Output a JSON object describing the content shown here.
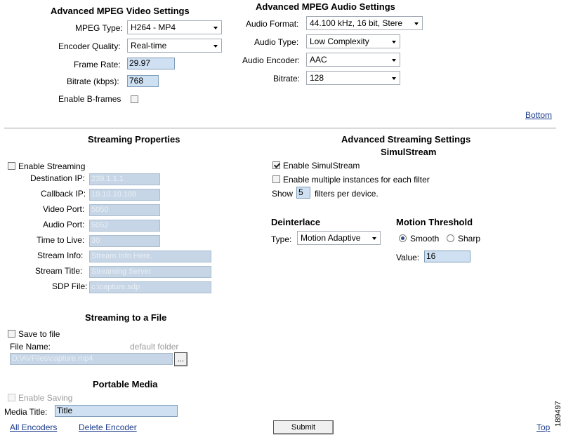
{
  "video": {
    "heading": "Advanced MPEG Video Settings",
    "mpeg_type_label": "MPEG Type:",
    "mpeg_type_value": "H264 - MP4",
    "encoder_quality_label": "Encoder Quality:",
    "encoder_quality_value": "Real-time",
    "frame_rate_label": "Frame Rate:",
    "frame_rate_value": "29.97",
    "bitrate_label": "Bitrate (kbps):",
    "bitrate_value": "768",
    "bframes_label": "Enable B-frames"
  },
  "audio": {
    "heading": "Advanced MPEG Audio Settings",
    "format_label": "Audio Format:",
    "format_value": "44.100 kHz, 16 bit, Stere",
    "type_label": "Audio Type:",
    "type_value": "Low Complexity",
    "encoder_label": "Audio Encoder:",
    "encoder_value": "AAC",
    "bitrate_label": "Bitrate:",
    "bitrate_value": "128"
  },
  "bottom_link": "Bottom",
  "streaming": {
    "heading": "Streaming Properties",
    "enable_label": "Enable Streaming",
    "dest_ip_label": "Destination IP:",
    "dest_ip_value": "239.1.1.1",
    "callback_ip_label": "Callback IP:",
    "callback_ip_value": "10.10.10.108",
    "video_port_label": "Video Port:",
    "video_port_value": "5050",
    "audio_port_label": "Audio Port:",
    "audio_port_value": "5052",
    "ttl_label": "Time to Live:",
    "ttl_value": "30",
    "stream_info_label": "Stream Info:",
    "stream_info_value": "Stream Info Here.",
    "stream_title_label": "Stream Title:",
    "stream_title_value": "Streaming Server",
    "sdp_label": "SDP File:",
    "sdp_value": "c:\\capture.sdp"
  },
  "advanced_streaming": {
    "heading": "Advanced Streaming Settings",
    "subheading": "SimulStream",
    "enable_simul_label": "Enable SimulStream",
    "multi_label": "Enable multiple instances for each filter",
    "show_label": "Show",
    "show_value": "5",
    "filters_label": "filters per device.",
    "deinterlace_heading": "Deinterlace",
    "type_label": "Type:",
    "type_value": "Motion Adaptive",
    "motion_heading": "Motion Threshold",
    "smooth_label": "Smooth",
    "sharp_label": "Sharp",
    "value_label": "Value:",
    "value_value": "16"
  },
  "file": {
    "heading": "Streaming to a File",
    "save_label": "Save to file",
    "file_name_label": "File Name:",
    "default_folder": "default folder",
    "path_value": "D:\\AVFiles\\capture.mp4",
    "browse_label": "..."
  },
  "portable": {
    "heading": "Portable Media",
    "enable_saving_label": "Enable Saving",
    "media_title_label": "Media Title:",
    "media_title_value": "Title"
  },
  "footer": {
    "all_encoders": "All Encoders",
    "delete_encoder": "Delete Encoder",
    "submit": "Submit",
    "top": "Top",
    "figure_id": "189497"
  }
}
